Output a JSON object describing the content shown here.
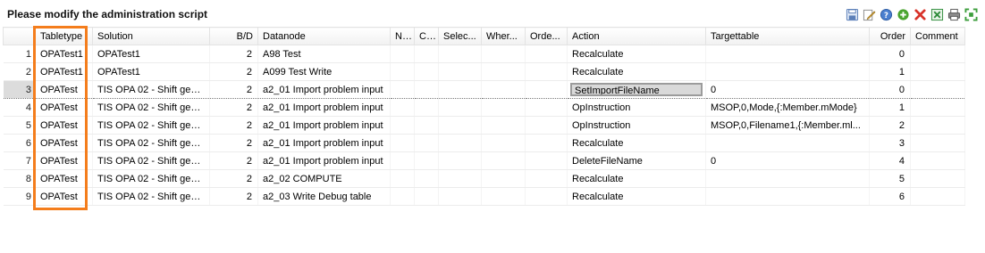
{
  "title": "Please modify the administration script",
  "toolbar": [
    {
      "name": "save-icon",
      "color": "#5b7fb8"
    },
    {
      "name": "edit-icon",
      "color": "#d8a43c"
    },
    {
      "name": "help-icon",
      "color": "#4a7fcf"
    },
    {
      "name": "add-icon",
      "color": "#4aa42f"
    },
    {
      "name": "delete-icon",
      "color": "#d8332a"
    },
    {
      "name": "excel-export-icon",
      "color": "#2e8b3a"
    },
    {
      "name": "print-icon",
      "color": "#555555"
    },
    {
      "name": "fullscreen-icon",
      "color": "#3c9e3c"
    }
  ],
  "columns": [
    "Tabletype",
    "Solution",
    "B/D",
    "Datanode",
    "N...",
    "C...",
    "Selec...",
    "Wher...",
    "Orde...",
    "Action",
    "Targettable",
    "Order",
    "Comment"
  ],
  "rows": [
    {
      "n": "1",
      "tabletype": "OPATest1",
      "solution": "OPATest1",
      "bd": "2",
      "datanode": "A98 Test",
      "action": "Recalculate",
      "target": "",
      "order": "0"
    },
    {
      "n": "2",
      "tabletype": "OPATest1",
      "solution": "OPATest1",
      "bd": "2",
      "datanode": "A099 Test Write",
      "action": "Recalculate",
      "target": "",
      "order": "1"
    },
    {
      "n": "3",
      "tabletype": "OPATest",
      "solution": "TIS OPA 02 - Shift gene...",
      "bd": "2",
      "datanode": "a2_01 Import problem input",
      "action": "SetImportFileName",
      "target": "0",
      "order": "0"
    },
    {
      "n": "4",
      "tabletype": "OPATest",
      "solution": "TIS OPA 02 - Shift gene...",
      "bd": "2",
      "datanode": "a2_01 Import problem input",
      "action": "OpInstruction",
      "target": "MSOP,0,Mode,{:Member.mMode}",
      "order": "1"
    },
    {
      "n": "5",
      "tabletype": "OPATest",
      "solution": "TIS OPA 02 - Shift gene...",
      "bd": "2",
      "datanode": "a2_01 Import problem input",
      "action": "OpInstruction",
      "target": "MSOP,0,Filename1,{:Member.ml...",
      "order": "2"
    },
    {
      "n": "6",
      "tabletype": "OPATest",
      "solution": "TIS OPA 02 - Shift gene...",
      "bd": "2",
      "datanode": "a2_01 Import problem input",
      "action": "Recalculate",
      "target": "",
      "order": "3"
    },
    {
      "n": "7",
      "tabletype": "OPATest",
      "solution": "TIS OPA 02 - Shift gene...",
      "bd": "2",
      "datanode": "a2_01 Import problem input",
      "action": "DeleteFileName",
      "target": "0",
      "order": "4"
    },
    {
      "n": "8",
      "tabletype": "OPATest",
      "solution": "TIS OPA 02 - Shift gene...",
      "bd": "2",
      "datanode": "a2_02 COMPUTE",
      "action": "Recalculate",
      "target": "",
      "order": "5"
    },
    {
      "n": "9",
      "tabletype": "OPATest",
      "solution": "TIS OPA 02 - Shift gene...",
      "bd": "2",
      "datanode": "a2_03 Write Debug table",
      "action": "Recalculate",
      "target": "",
      "order": "6"
    }
  ],
  "selected_row": "3",
  "highlight_color": "#f47d1c"
}
